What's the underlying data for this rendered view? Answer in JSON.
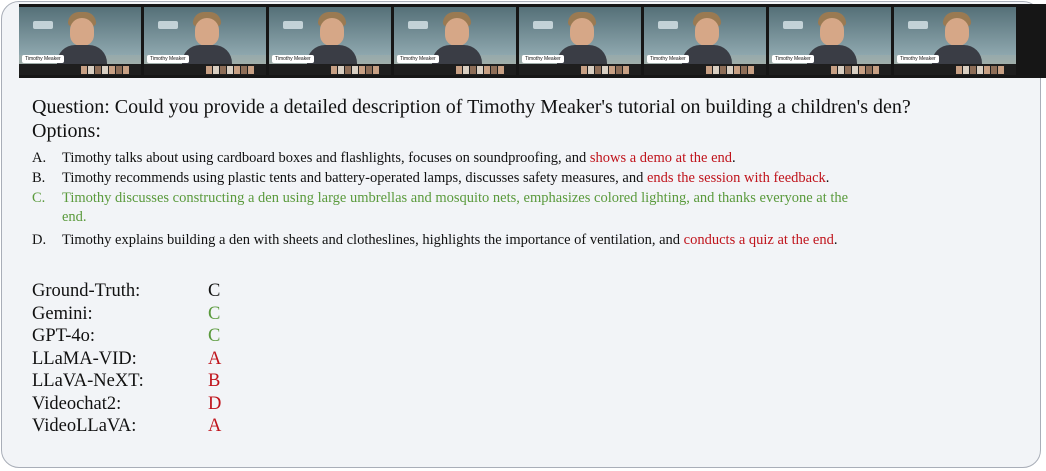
{
  "frames": [
    {
      "name_tag": "Timothy Meaker"
    },
    {
      "name_tag": "Timothy Meaker"
    },
    {
      "name_tag": "Timothy Meaker"
    },
    {
      "name_tag": "Timothy Meaker"
    },
    {
      "name_tag": "Timothy Meaker"
    },
    {
      "name_tag": "Timothy Meaker"
    },
    {
      "name_tag": "Timothy Meaker"
    },
    {
      "name_tag": "Timothy Meaker"
    }
  ],
  "question": "Question: Could you provide a detailed description of Timothy Meaker's tutorial on building a children's den?",
  "options_title": "Options:",
  "options": [
    {
      "letter": "A.",
      "text": "Timothy talks about using cardboard boxes and flashlights, focuses on soundproofing, and ",
      "highlight": "shows a demo at the end",
      "tail": "."
    },
    {
      "letter": "B.",
      "text": "Timothy recommends using plastic tents and battery-operated lamps, discusses safety measures, and ",
      "highlight": "ends the session with feedback",
      "tail": "."
    },
    {
      "letter": "C.",
      "line1": "Timothy discusses constructing a den using large umbrellas and mosquito nets, emphasizes colored lighting, and thanks everyone at the",
      "line2": "end."
    },
    {
      "letter": "D.",
      "text": "Timothy explains building a den with sheets and clotheslines, highlights the importance of ventilation, and ",
      "highlight": "conducts a quiz at the end",
      "tail": "."
    }
  ],
  "results": [
    {
      "model": "Ground-Truth:",
      "answer": "C"
    },
    {
      "model": "Gemini:",
      "answer": "C"
    },
    {
      "model": "GPT-4o:",
      "answer": "C"
    },
    {
      "model": "LLaMA-VID:",
      "answer": "A"
    },
    {
      "model": "LLaVA-NeXT:",
      "answer": "B"
    },
    {
      "model": "Videochat2:",
      "answer": "D"
    },
    {
      "model": "VideoLLaVA:",
      "answer": "A"
    }
  ],
  "colors": {
    "wrong": "#c0141c",
    "correct": "#5a9a3c",
    "neutral": "#111111",
    "panel": "#f2f4f7"
  }
}
